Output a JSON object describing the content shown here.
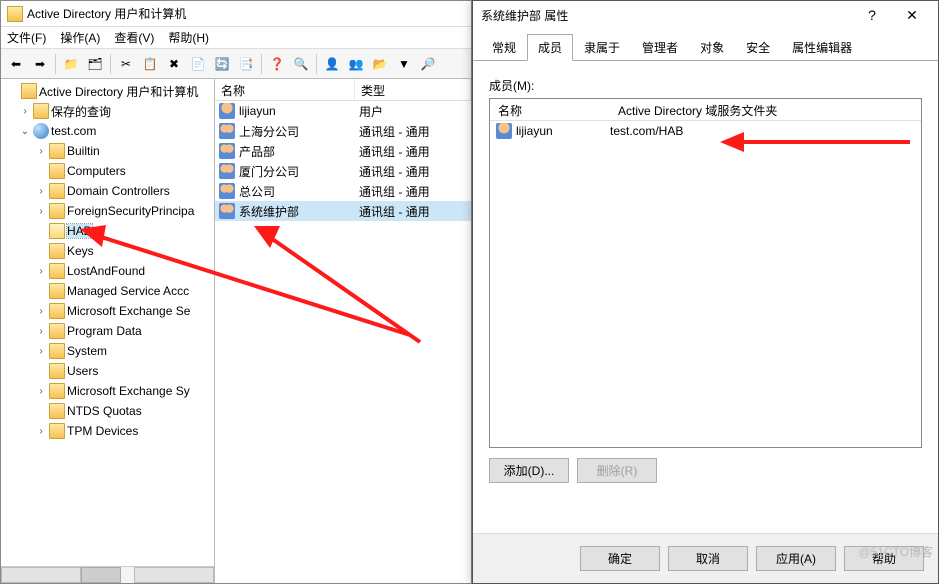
{
  "main": {
    "title": "Active Directory 用户和计算机",
    "menu": {
      "file": "文件(F)",
      "action": "操作(A)",
      "view": "查看(V)",
      "help": "帮助(H)"
    },
    "tree": {
      "root": "Active Directory 用户和计算机",
      "saved": "保存的查询",
      "domain": "test.com",
      "nodes": [
        "Builtin",
        "Computers",
        "Domain Controllers",
        "ForeignSecurityPrincipa",
        "HAB",
        "Keys",
        "LostAndFound",
        "Managed Service Accc",
        "Microsoft Exchange Se",
        "Program Data",
        "System",
        "Users",
        "Microsoft Exchange Sy",
        "NTDS Quotas",
        "TPM Devices"
      ]
    },
    "columns": {
      "name": "名称",
      "type": "类型"
    },
    "rows": [
      {
        "name": "lijiayun",
        "type": "用户",
        "icon": "user"
      },
      {
        "name": "上海分公司",
        "type": "通讯组 - 通用",
        "icon": "group"
      },
      {
        "name": "产品部",
        "type": "通讯组 - 通用",
        "icon": "group"
      },
      {
        "name": "厦门分公司",
        "type": "通讯组 - 通用",
        "icon": "group"
      },
      {
        "name": "总公司",
        "type": "通讯组 - 通用",
        "icon": "group"
      },
      {
        "name": "系统维护部",
        "type": "通讯组 - 通用",
        "icon": "group"
      }
    ]
  },
  "dialog": {
    "title": "系统维护部 属性",
    "tabs": [
      "常规",
      "成员",
      "隶属于",
      "管理者",
      "对象",
      "安全",
      "属性编辑器"
    ],
    "active_tab_index": 1,
    "members_label": "成员(M):",
    "member_cols": {
      "name": "名称",
      "folder": "Active Directory 域服务文件夹"
    },
    "members": [
      {
        "name": "lijiayun",
        "folder": "test.com/HAB"
      }
    ],
    "buttons": {
      "add": "添加(D)...",
      "remove": "删除(R)",
      "ok": "确定",
      "cancel": "取消",
      "apply": "应用(A)",
      "help": "帮助"
    }
  },
  "watermark": "@51CTO博客"
}
